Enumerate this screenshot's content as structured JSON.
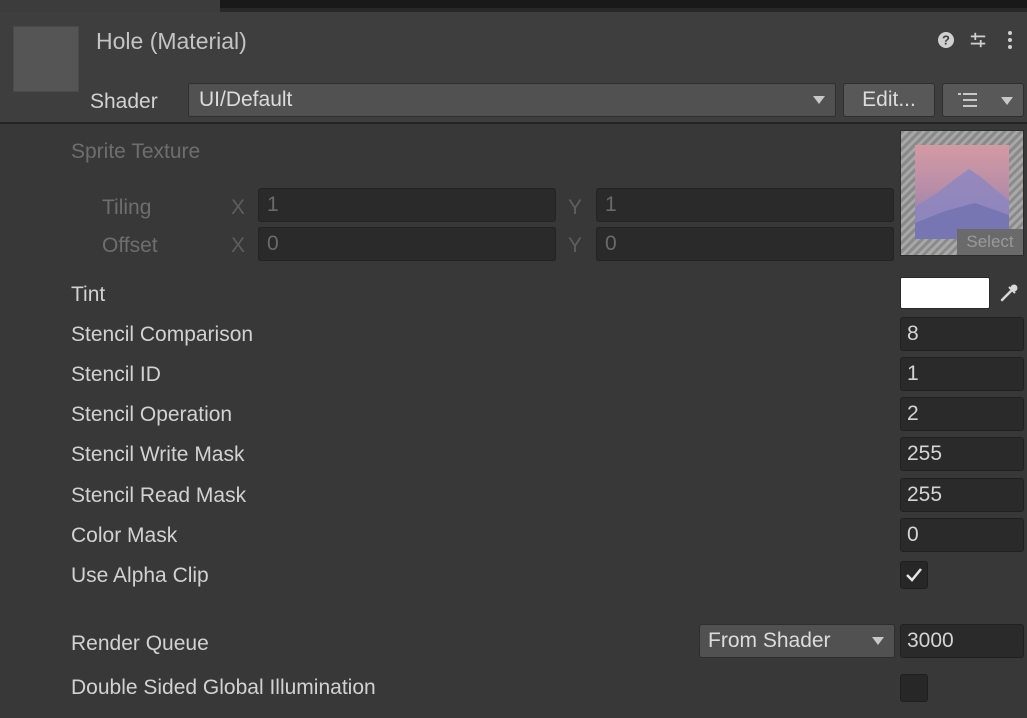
{
  "header": {
    "title": "Hole (Material)",
    "shader_label": "Shader",
    "shader_value": "UI/Default",
    "edit_label": "Edit...",
    "icons": [
      "help-icon",
      "preset-icon",
      "more-icon",
      "list-icon"
    ]
  },
  "sprite_texture": {
    "label": "Sprite Texture",
    "tiling": {
      "label": "Tiling",
      "x_axis": "X",
      "x_value": "1",
      "y_axis": "Y",
      "y_value": "1"
    },
    "offset": {
      "label": "Offset",
      "x_axis": "X",
      "x_value": "0",
      "y_axis": "Y",
      "y_value": "0"
    },
    "select_label": "Select"
  },
  "properties": {
    "tint": {
      "label": "Tint",
      "color": "#ffffff"
    },
    "stencil_comparison": {
      "label": "Stencil Comparison",
      "value": "8"
    },
    "stencil_id": {
      "label": "Stencil ID",
      "value": "1"
    },
    "stencil_operation": {
      "label": "Stencil Operation",
      "value": "2"
    },
    "stencil_write_mask": {
      "label": "Stencil Write Mask",
      "value": "255"
    },
    "stencil_read_mask": {
      "label": "Stencil Read Mask",
      "value": "255"
    },
    "color_mask": {
      "label": "Color Mask",
      "value": "0"
    },
    "use_alpha_clip": {
      "label": "Use Alpha Clip",
      "checked": true
    },
    "render_queue": {
      "label": "Render Queue",
      "mode": "From Shader",
      "value": "3000"
    },
    "double_sided_gi": {
      "label": "Double Sided Global Illumination",
      "checked": false
    }
  }
}
